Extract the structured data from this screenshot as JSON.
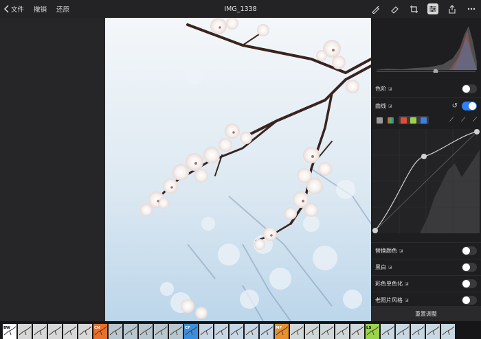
{
  "toolbar": {
    "back_label": "文件",
    "undo_label": "撤销",
    "revert_label": "还原",
    "title": "IMG_1338",
    "icons": [
      "brush-pen-icon",
      "eraser-icon",
      "crop-icon",
      "adjust-sliders-icon",
      "share-icon",
      "more-icon"
    ]
  },
  "adjustments": {
    "levels": {
      "label": "色阶",
      "on": false
    },
    "curves": {
      "label": "曲线",
      "on": true
    },
    "replace_color": {
      "label": "替换颜色",
      "on": false
    },
    "black_white": {
      "label": "黑白",
      "on": false
    },
    "color_mono": {
      "label": "彩色单色化",
      "on": false
    },
    "vintage": {
      "label": "老照片风格",
      "on": false
    },
    "reset_label": "重置调整"
  },
  "curve_channels": [
    "luma",
    "rgb",
    "red",
    "green",
    "blue"
  ],
  "filmstrip": {
    "groups": [
      {
        "tag": "BW",
        "color": "#ffffff",
        "tag_text_color": "#000000"
      },
      {
        "tag": "CN",
        "color": "#e8702a",
        "tag_text_color": "#ffffff"
      },
      {
        "tag": "CF",
        "color": "#3a8ee0",
        "tag_text_color": "#ffffff"
      },
      {
        "tag": "MF",
        "color": "#e8902a",
        "tag_text_color": "#ffffff"
      },
      {
        "tag": "LS",
        "color": "#9ad44a",
        "tag_text_color": "#000000"
      }
    ]
  },
  "colors": {
    "accent": "#2f7ff6"
  }
}
